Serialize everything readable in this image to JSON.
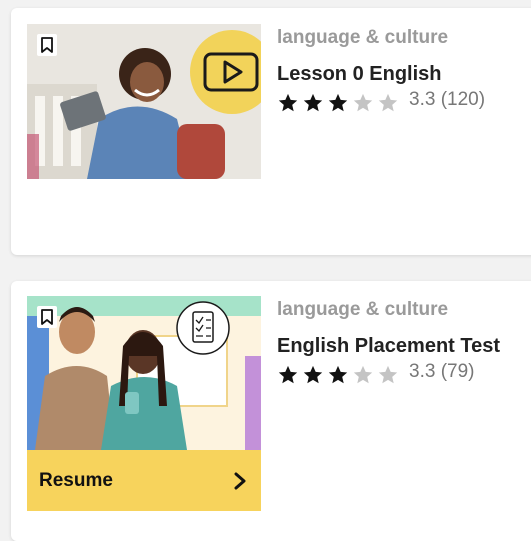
{
  "courses": [
    {
      "category": "language & culture",
      "title": "Lesson 0 English",
      "rating": 3.3,
      "rating_text": "3.3 (120)",
      "stars_filled": 3,
      "stars_total": 5,
      "thumbnail_icon": "play-video-icon",
      "thumbnail_bg": "#eceae6",
      "accent_circle": "#f2d35a"
    },
    {
      "category": "language & culture",
      "title": "English Placement Test",
      "rating": 3.3,
      "rating_text": "3.3 (79)",
      "stars_filled": 3,
      "stars_total": 5,
      "thumbnail_icon": "checklist-icon",
      "resume_label": "Resume",
      "resume_color": "#f7d35c"
    }
  ],
  "colors": {
    "star_filled": "#111111",
    "star_empty": "#c4c4c4",
    "category": "#9a9a9a",
    "title": "#222222"
  }
}
